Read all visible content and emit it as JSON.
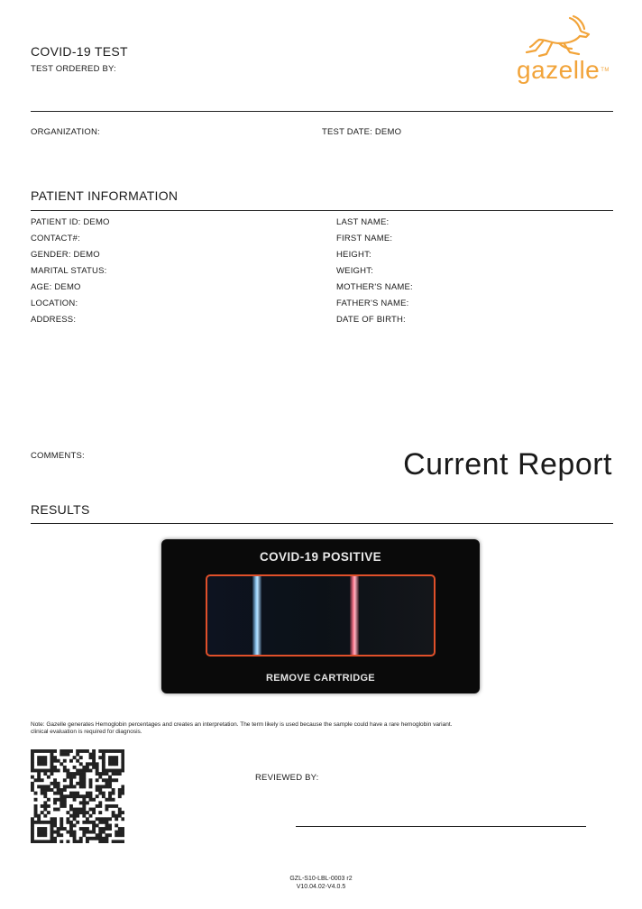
{
  "header": {
    "title": "COVID-19 TEST",
    "ordered_by": "TEST ORDERED BY:",
    "logo_text": "gazelle",
    "logo_tm": "TM",
    "logo_color": "#f2a43a"
  },
  "org_row": {
    "organization": "ORGANIZATION:",
    "test_date": "TEST DATE: DEMO"
  },
  "patient": {
    "heading": "PATIENT INFORMATION",
    "left": [
      "PATIENT ID: DEMO",
      "CONTACT#:",
      "GENDER: DEMO",
      "MARITAL STATUS:",
      "AGE: DEMO",
      "LOCATION:",
      "ADDRESS:"
    ],
    "right": [
      "LAST NAME:",
      "FIRST NAME:",
      "HEIGHT:",
      "WEIGHT:",
      "MOTHER'S NAME:",
      "FATHER'S NAME:",
      "DATE OF BIRTH:"
    ]
  },
  "comments_label": "COMMENTS:",
  "report_title": "Current Report",
  "results": {
    "heading": "RESULTS",
    "device_title": "COVID-19 POSITIVE",
    "device_footer": "REMOVE CARTRIDGE",
    "cartridge_border_color": "#e0502a",
    "control_band_color": "#8fc8f0",
    "test_band_color": "#ff7a90"
  },
  "note": {
    "line1": "Note: Gazelle generates Hemoglobin percentages and creates an interpretation. The term likely is used because the sample could have a rare hemoglobin variant.",
    "line2": "clinical evaluation is required for diagnosis."
  },
  "reviewed_by": "REVIEWED BY:",
  "footer": {
    "line1": "GZL-S10-LBL-0003 r2",
    "line2": "V10.04.02-V4.0.5"
  }
}
